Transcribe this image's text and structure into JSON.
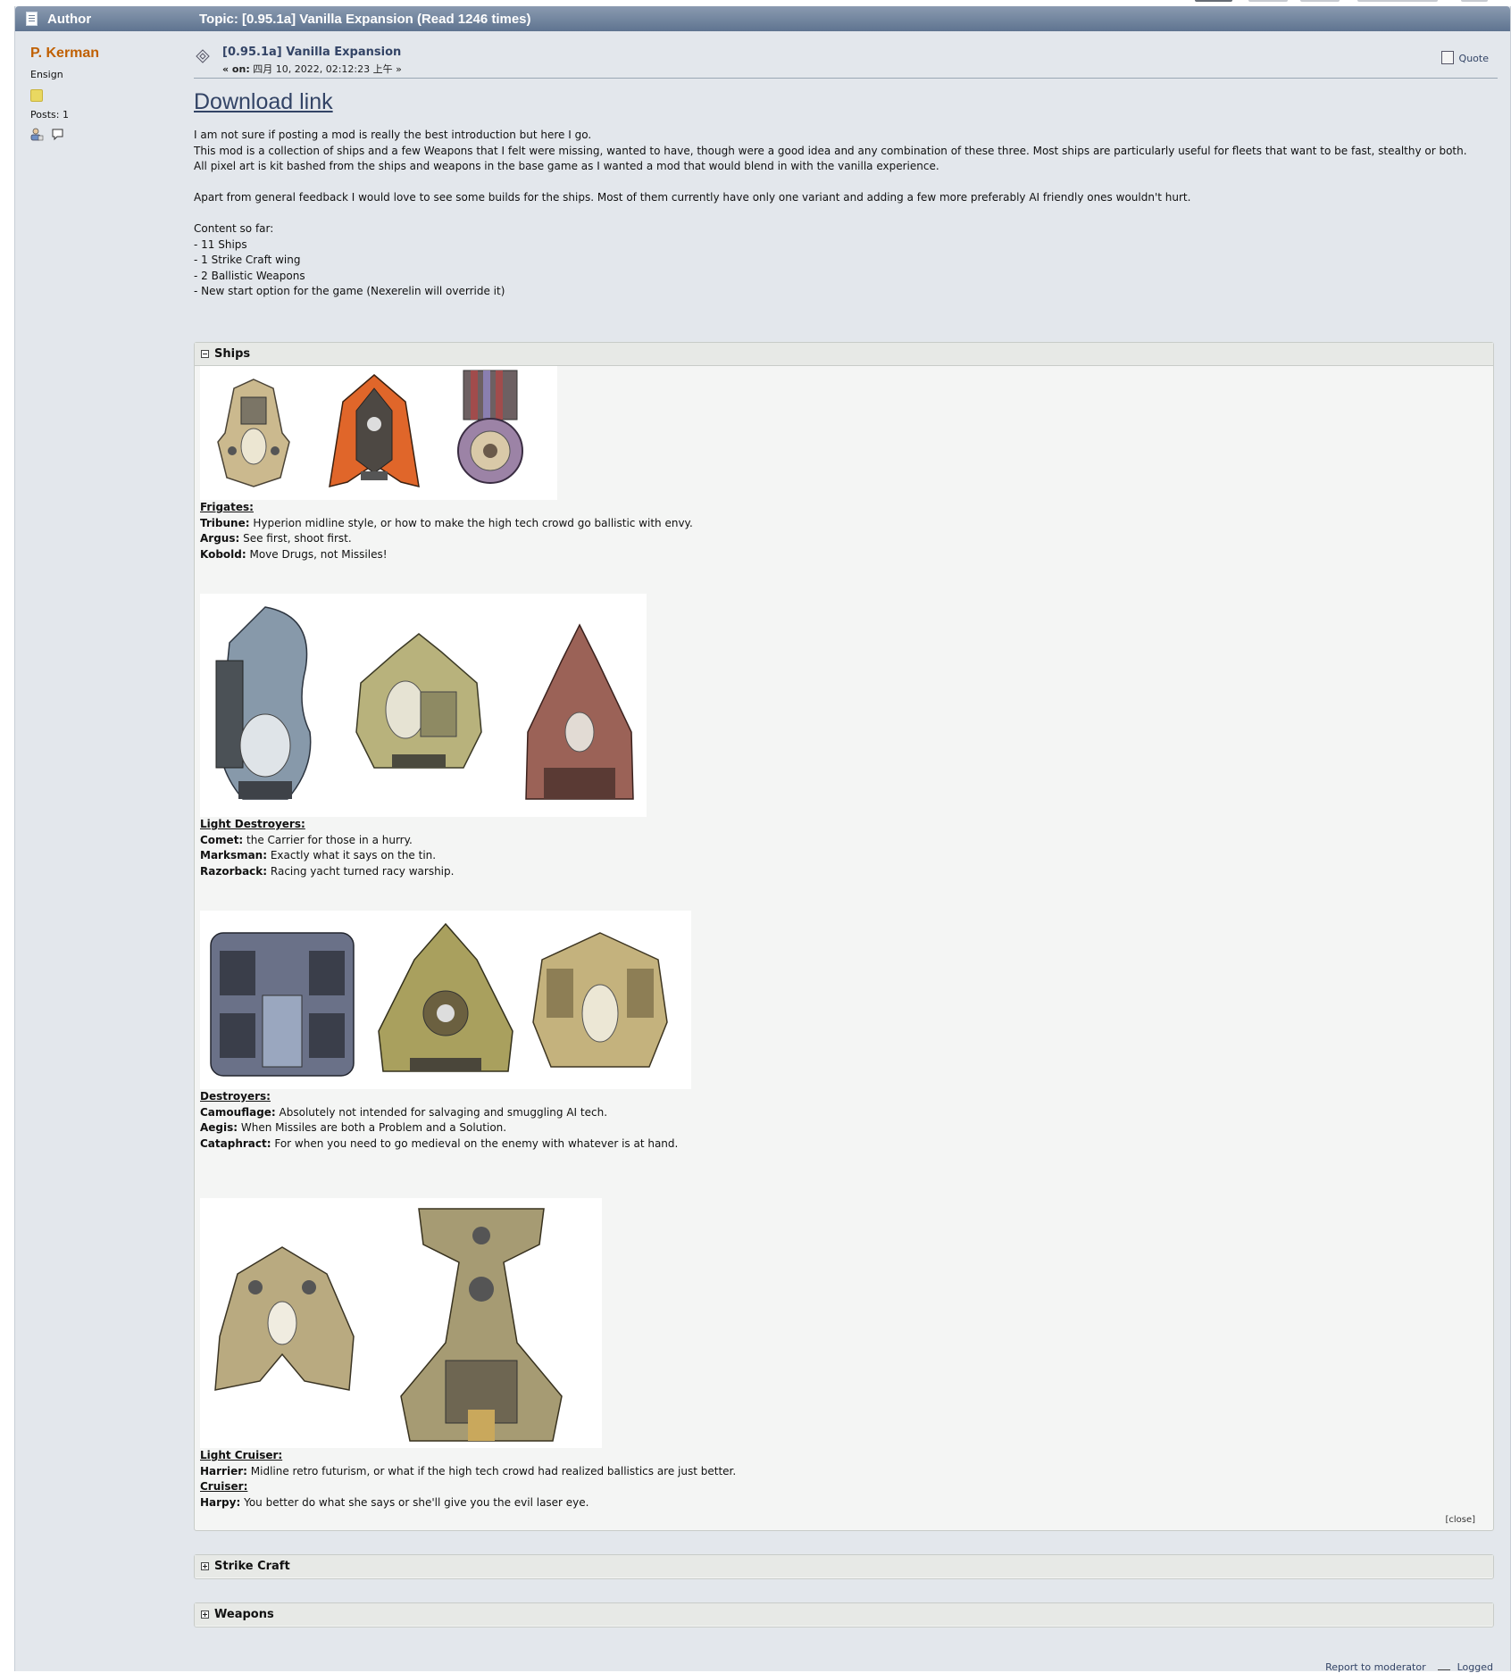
{
  "header": {
    "author_label": "Author",
    "topic_label": "Topic: [0.95.1a] Vanilla Expansion  (Read 1246 times)"
  },
  "poster": {
    "name": "P. Kerman",
    "rank": "Ensign",
    "posts": "Posts: 1",
    "profile_icon": "user-profile-icon",
    "message_icon": "speech-bubble-icon"
  },
  "post": {
    "subject": "[0.95.1a] Vanilla Expansion",
    "meta_on": "« on:",
    "meta_date": " 四月 10, 2022, 02:12:23 上午 »",
    "quote_label": "Quote",
    "download_link": "Download link",
    "intro": [
      "I am not sure if posting a mod is really the best introduction but here I go.",
      "This mod is a collection of ships and a few Weapons that I felt were missing, wanted to have, though were a good idea and any combination of these three. Most ships are particularly useful for fleets that want to be fast, stealthy or both.",
      "All pixel art is kit bashed from the ships and weapons in the base game as I wanted a mod that would blend in with the vanilla experience.",
      "",
      "Apart from general feedback I would love to see some builds for the ships. Most of them currently have only one variant and adding a few more preferably AI friendly ones wouldn't hurt.",
      "",
      "Content so far:",
      "-   11 Ships",
      "-   1 Strike Craft wing",
      "-   2 Ballistic Weapons",
      "-   New start option for the game (Nexerelin will override it)"
    ]
  },
  "spoilers": {
    "ships": {
      "title": "Ships",
      "close_label": "[close]",
      "frigates": {
        "heading": "Frigates:",
        "items": [
          {
            "name": "Tribune:",
            "text": " Hyperion midline style, or how to make the high tech crowd go ballistic with envy."
          },
          {
            "name": "Argus:",
            "text": " See first, shoot first."
          },
          {
            "name": "Kobold:",
            "text": " Move Drugs, not Missiles!"
          }
        ]
      },
      "light_destroyers": {
        "heading": "Light Destroyers:",
        "items": [
          {
            "name": "Comet:",
            "text": " the Carrier for those in a hurry."
          },
          {
            "name": "Marksman:",
            "text": " Exactly what it says on the tin."
          },
          {
            "name": "Razorback:",
            "text": " Racing yacht turned racy warship."
          }
        ]
      },
      "destroyers": {
        "heading": "Destroyers:",
        "items": [
          {
            "name": "Camouflage:",
            "text": " Absolutely not intended for salvaging and smuggling AI tech."
          },
          {
            "name": "Aegis:",
            "text": " When Missiles are both a Problem and a Solution."
          },
          {
            "name": "Cataphract:",
            "text": " For when you need to go medieval on the enemy with whatever is at hand."
          }
        ]
      },
      "light_cruiser": {
        "heading": "Light Cruiser:",
        "items": [
          {
            "name": "Harrier:",
            "text": " Midline retro futurism, or what if the high tech crowd had realized ballistics are just better."
          }
        ]
      },
      "cruiser": {
        "heading": "Cruiser:",
        "items": [
          {
            "name": "Harpy:",
            "text": " You better do what she says or she'll give you the evil laser eye."
          }
        ]
      }
    },
    "strike_craft": {
      "title": "Strike Craft"
    },
    "weapons": {
      "title": "Weapons"
    }
  },
  "footer": {
    "report": "Report to moderator",
    "logged": "Logged"
  },
  "colors": {
    "poster_name": "#c06002",
    "cat_bar": "#6f839e",
    "link": "#334466"
  }
}
